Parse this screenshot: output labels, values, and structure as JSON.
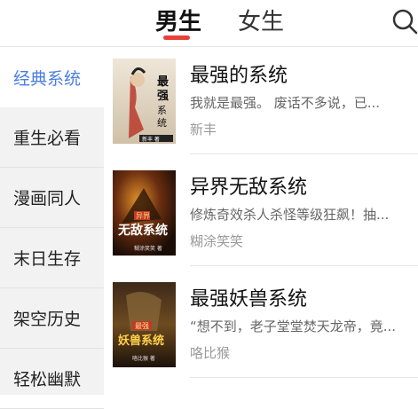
{
  "tabs": {
    "male": "男生",
    "female": "女生"
  },
  "colors": {
    "accent": "#e8413a",
    "active_category": "#4a7ee0"
  },
  "sidebar": {
    "items": [
      {
        "label": "经典系统",
        "active": true
      },
      {
        "label": "重生必看"
      },
      {
        "label": "漫画同人"
      },
      {
        "label": "末日生存"
      },
      {
        "label": "架空历史"
      },
      {
        "label": "轻松幽默"
      }
    ]
  },
  "books": [
    {
      "title": "最强的系统",
      "description": "我就是最强。 废话不多说，已...",
      "author": "新丰",
      "cover_text": "最强的系统",
      "cover_author": "新丰 著"
    },
    {
      "title": "异界无敌系统",
      "description": "修炼奇效杀人杀怪等级狂飙！抽...",
      "author": "糊涂笑笑",
      "cover_text": "无敌系统",
      "cover_badge": "异界",
      "cover_author": "糊涂笑笑 著"
    },
    {
      "title": "最强妖兽系统",
      "description": "“想不到，老子堂堂焚天龙帝，竟...",
      "author": "咯比猴",
      "cover_text": "妖兽系统",
      "cover_badge": "最强",
      "cover_author": "咯比猴 著"
    }
  ]
}
